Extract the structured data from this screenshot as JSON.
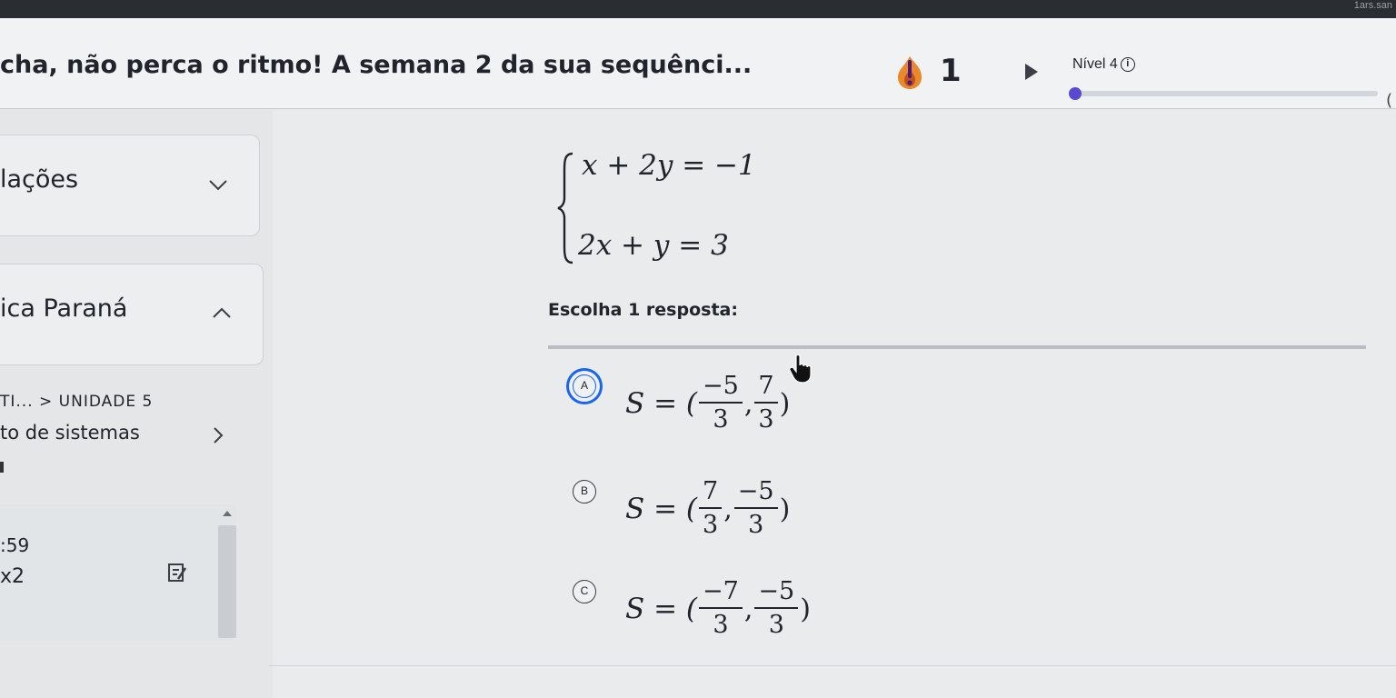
{
  "system": {
    "clock": "1ars.san"
  },
  "header": {
    "title": "cha, não perca o ritmo! A semana 2 da sua sequênci...",
    "streak_count": "1",
    "level_label": "Nível 4",
    "info_glyph": "i",
    "edge_char": "(",
    "progress_fraction": 0.01,
    "accent_color": "#5b49d1"
  },
  "sidebar": {
    "card1_title": "lações",
    "card2_title": "ica Paraná",
    "breadcrumb": "TI... > UNIDADE 5",
    "unit_name": "to de sistemas",
    "stat_a": ":59",
    "stat_b": "x2"
  },
  "question": {
    "equation_1": "x + 2y = −1",
    "equation_2": "2x + y = 3",
    "prompt": "Escolha 1 resposta:"
  },
  "choices": [
    {
      "letter": "A",
      "prefix": "S = (",
      "x_num": "−5",
      "x_den": "3",
      "y_num": "7",
      "y_den": "3",
      "suffix": ")",
      "selected": true
    },
    {
      "letter": "B",
      "prefix": "S = (",
      "x_num": "7",
      "x_den": "3",
      "y_num": "−5",
      "y_den": "3",
      "suffix": ")",
      "selected": false
    },
    {
      "letter": "C",
      "prefix": "S = (",
      "x_num": "−7",
      "x_den": "3",
      "y_num": "−5",
      "y_den": "3",
      "suffix": ")",
      "selected": false
    }
  ],
  "colors": {
    "selected_ring": "#1865f2",
    "streak_orange": "#e8892b"
  }
}
